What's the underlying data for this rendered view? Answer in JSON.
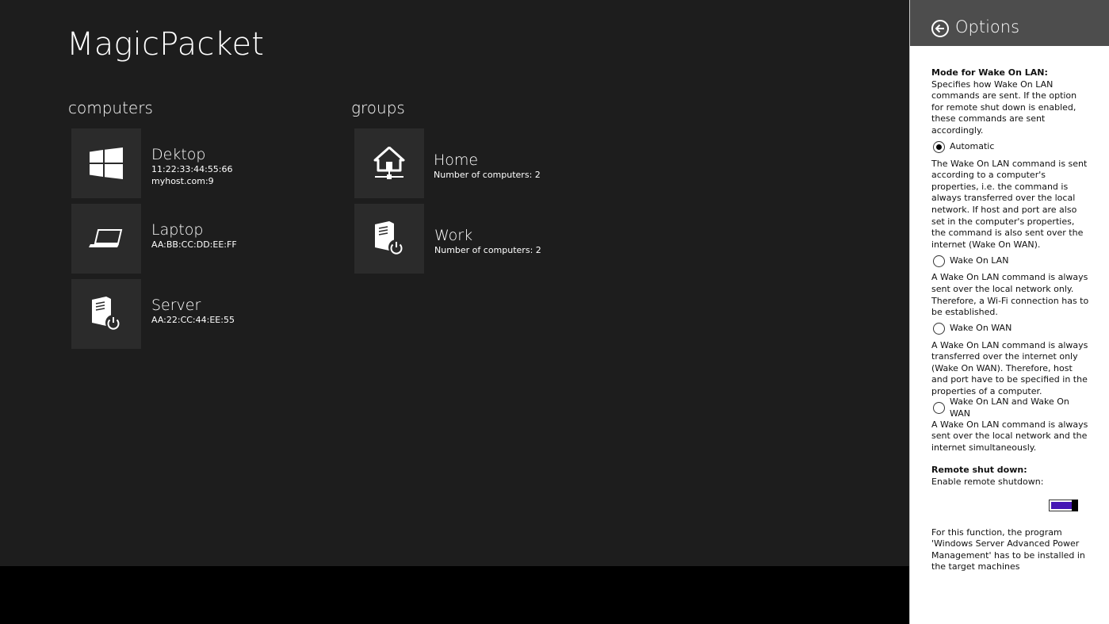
{
  "app": {
    "title": "MagicPacket"
  },
  "computers": {
    "title": "computers",
    "items": [
      {
        "name": "Dektop",
        "line1": "11:22:33:44:55:66",
        "line2": "myhost.com:9",
        "icon": "windows-logo-icon"
      },
      {
        "name": "Laptop",
        "line1": "AA:BB:CC:DD:EE:FF",
        "icon": "laptop-icon"
      },
      {
        "name": "Server",
        "line1": "AA:22:CC:44:EE:55",
        "icon": "server-power-icon"
      }
    ]
  },
  "groups": {
    "title": "groups",
    "items": [
      {
        "name": "Home",
        "line1": "Number of computers: 2",
        "icon": "home-network-icon"
      },
      {
        "name": "Work",
        "line1": "Number of computers: 2",
        "icon": "server-power-icon"
      }
    ]
  },
  "options": {
    "title": "Options",
    "mode_heading": "Mode for Wake On LAN:",
    "mode_desc": "Specifies how Wake On LAN commands are sent. If the option for remote shut down is enabled, these commands are sent accordingly.",
    "modes": [
      {
        "label": "Automatic",
        "checked": true,
        "desc": "The Wake On LAN command is sent according to a computer's properties, i.e. the command is always transferred over the local network. If host and port are also set in the computer's properties, the command is also sent over the internet (Wake On WAN)."
      },
      {
        "label": "Wake On LAN",
        "checked": false,
        "desc": "A Wake On LAN command is always sent over the local network only. Therefore, a Wi-Fi connection has to be established."
      },
      {
        "label": "Wake On WAN",
        "checked": false,
        "desc": "A Wake On LAN command is always transferred over the internet only (Wake On WAN). Therefore, host and port have to be specified in the properties of a computer."
      },
      {
        "label": "Wake On LAN and Wake On WAN",
        "checked": false,
        "desc": "A Wake On LAN command is always sent over the local network and the internet simultaneously."
      }
    ],
    "shutdown_heading": "Remote shut down:",
    "shutdown_label": "Enable remote shutdown:",
    "shutdown_enabled": true,
    "shutdown_note": "For this function, the program 'Windows Server Advanced Power Management' has to be installed in the target machines"
  },
  "colors": {
    "background": "#1d1d1d",
    "tile": "#2b2b2b",
    "flyout_header": "#4d4d4d",
    "toggle_accent": "#4617b4"
  }
}
